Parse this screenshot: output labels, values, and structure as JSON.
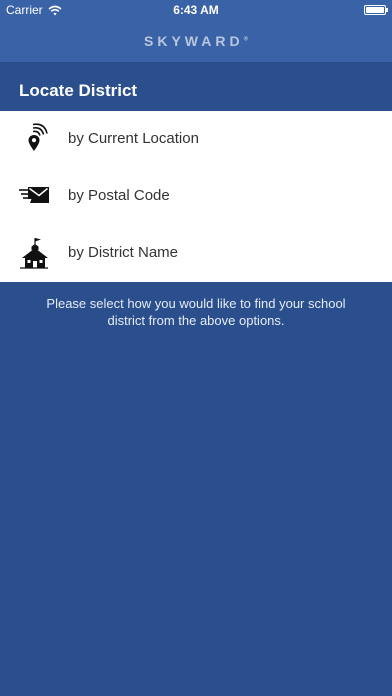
{
  "status_bar": {
    "carrier": "Carrier",
    "time": "6:43 AM"
  },
  "nav_bar": {
    "logo_text": "SKYWARD",
    "logo_mark": "®"
  },
  "section": {
    "title": "Locate District"
  },
  "options": [
    {
      "label": "by Current Location",
      "icon": "location-pin-icon"
    },
    {
      "label": "by Postal Code",
      "icon": "envelope-icon"
    },
    {
      "label": "by District Name",
      "icon": "schoolhouse-icon"
    }
  ],
  "hint": "Please select how you would like to find your school district from the above options.",
  "colors": {
    "background": "#2b4e8d",
    "nav_bar": "#3a62a6",
    "list_background": "#ffffff",
    "list_text": "#333333"
  }
}
